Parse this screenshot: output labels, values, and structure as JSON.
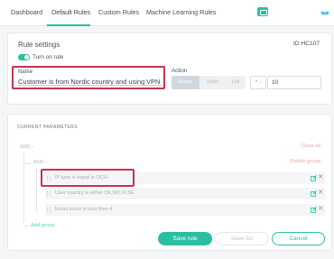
{
  "nav": {
    "tabs": [
      "Dashboard",
      "Default Rules",
      "Custom Rules",
      "Machine Learning Rules"
    ],
    "active_tab": "Default Rules"
  },
  "rule_settings": {
    "title": "Rule settings",
    "rule_id": "ID HC107",
    "toggle_label": "Turn on rule",
    "toggle_on": true,
    "name_label": "Name",
    "name_value": "Customer is from Nordic country and using VPN",
    "action_label": "Action",
    "action_options": [
      "Score",
      "Stats",
      "List"
    ],
    "action_selected": "Score",
    "operator": "+ -",
    "score_value": "10"
  },
  "parameters": {
    "title": "CURRENT PARAMETERS",
    "outer_operator": "AND -",
    "clear_all": "Clear all",
    "inner_operator": "AND -",
    "delete_group": "Delete group",
    "conditions": [
      "IP type is equal to DCH",
      "User country is either DK,NO,FI,SE",
      "Email score is less than 4"
    ],
    "add_group": "Add group"
  },
  "buttons": {
    "save": "Save rule",
    "save_list": "Save list",
    "cancel": "Cancel"
  },
  "colors": {
    "accent": "#2bbfa1",
    "highlight": "#c8324f",
    "delete": "#e46a6a"
  }
}
